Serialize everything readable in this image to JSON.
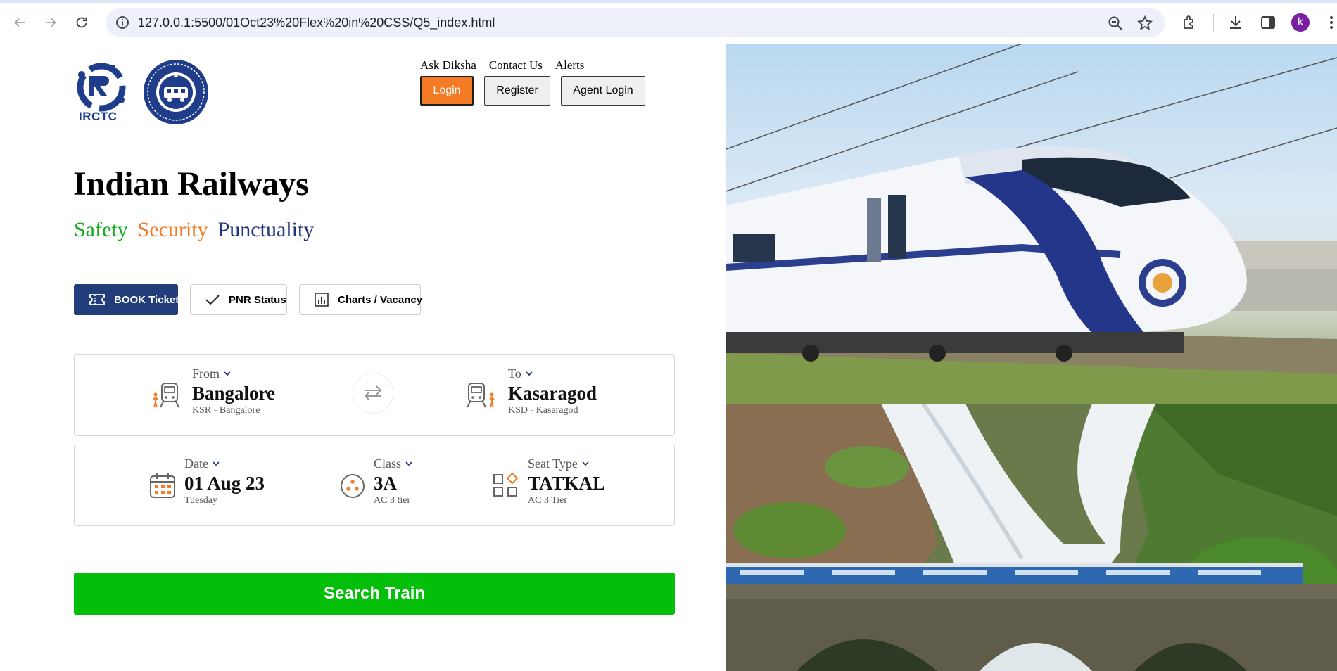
{
  "browser": {
    "url": "127.0.0.1:5500/01Oct23%20Flex%20in%20CSS/Q5_index.html",
    "avatar_letter": "k",
    "avatar_color": "#7b1fa2"
  },
  "header": {
    "logo_irctc_text": "IRCTC",
    "links": [
      "Ask Diksha",
      "Contact Us",
      "Alerts"
    ],
    "buttons": {
      "login": "Login",
      "register": "Register",
      "agent_login": "Agent Login"
    }
  },
  "hero": {
    "title": "Indian Railways",
    "taglines": [
      "Safety",
      "Security",
      "Punctuality"
    ]
  },
  "services": [
    {
      "label": "BOOK Ticket",
      "icon": "ticket-icon",
      "active": true
    },
    {
      "label": "PNR Status",
      "icon": "check-icon",
      "active": false
    },
    {
      "label": "Charts / Vacancy",
      "icon": "bar-chart-icon",
      "active": false
    }
  ],
  "journey": {
    "from": {
      "label": "From",
      "value": "Bangalore",
      "sub": "KSR - Bangalore"
    },
    "to": {
      "label": "To",
      "value": "Kasaragod",
      "sub": "KSD - Kasaragod"
    },
    "date": {
      "label": "Date",
      "value": "01 Aug 23",
      "sub": "Tuesday"
    },
    "class": {
      "label": "Class",
      "value": "3A",
      "sub": "AC 3 tier"
    },
    "seat_type": {
      "label": "Seat Type",
      "value": "TATKAL",
      "sub": "AC 3 Tier"
    }
  },
  "search_button": "Search Train",
  "colors": {
    "orange": "#f47a26",
    "green": "#04bf0a",
    "navy": "#213d7a",
    "tag_green": "#12a91a",
    "tag_blue": "#20357a"
  }
}
